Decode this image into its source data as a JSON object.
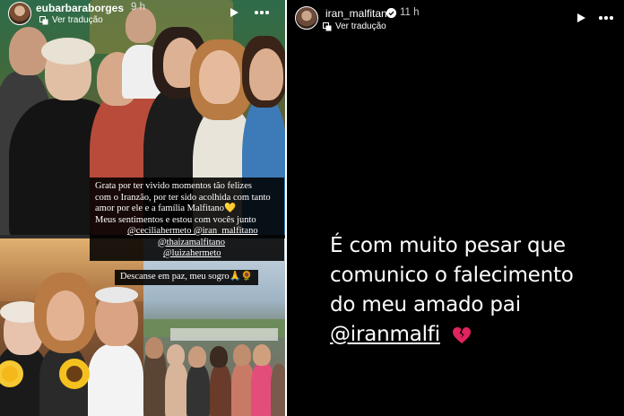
{
  "left_story": {
    "username": "eubarbaraborges",
    "time": "9 h",
    "translate_label": "Ver tradução",
    "caption_lines": [
      "Grata por ter vivido momentos tão felizes",
      "com o Iranzão, por ter sido acolhida com tanto",
      "amor por ele e a família Malfitano💛",
      "Meus sentimentos e estou com vocês junto",
      "@ceciliahermeto @iran_malfitano",
      "@thaizamalfitano",
      "@luizahermeto"
    ],
    "caption_2": "Descanse em paz, meu sogro🙏🌻"
  },
  "right_story": {
    "username": "iran_malfitano",
    "time": "11 h",
    "translate_label": "Ver tradução",
    "text_lines": [
      "É com muito pesar que",
      "comunico o falecimento",
      "do meu amado pai",
      "@iranmalfi"
    ]
  },
  "colors": {
    "right_background": "#000000",
    "caption_background": "#000000",
    "heart": "#e0245e"
  },
  "icons": [
    "play-icon",
    "more-icon",
    "translate-icon",
    "verified-icon",
    "broken-heart-icon"
  ]
}
